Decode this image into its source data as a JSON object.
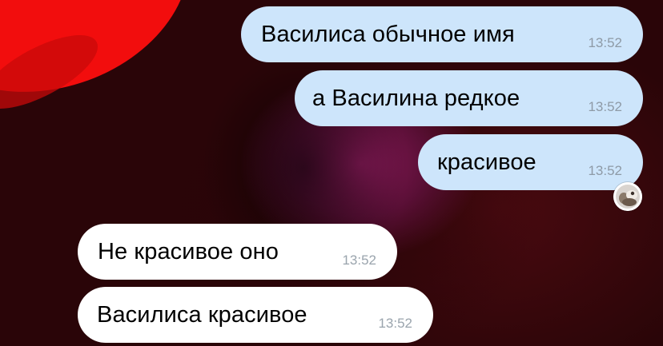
{
  "messages": [
    {
      "direction": "outgoing",
      "text": "Василиса обычное имя",
      "time": "13:52"
    },
    {
      "direction": "outgoing",
      "text": "а Василина редкое",
      "time": "13:52"
    },
    {
      "direction": "outgoing",
      "text": "красивое",
      "time": "13:52"
    },
    {
      "direction": "incoming",
      "text": "Не красивое оно",
      "time": "13:52"
    },
    {
      "direction": "incoming",
      "text": "Василиса красивое",
      "time": "13:52"
    }
  ],
  "colors": {
    "outgoing_bubble": "#cde5fb",
    "incoming_bubble": "#ffffff",
    "timestamp": "#8e9aa6"
  },
  "icons": {
    "avatar": "sender-avatar-icon"
  }
}
